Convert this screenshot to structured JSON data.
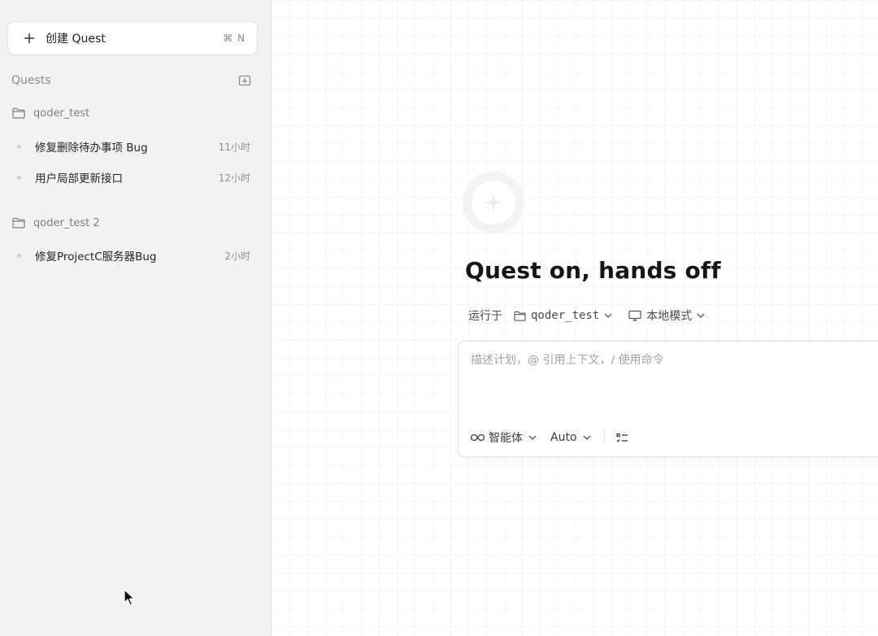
{
  "sidebar": {
    "new_quest": {
      "label": "创建 Quest",
      "shortcut": "⌘ N"
    },
    "section_title": "Quests",
    "groups": [
      {
        "folder": "qoder_test",
        "items": [
          {
            "title": "修复删除待办事项 Bug",
            "time": "11小时"
          },
          {
            "title": "用户局部更新接口",
            "time": "12小时"
          }
        ]
      },
      {
        "folder": "qoder_test 2",
        "items": [
          {
            "title": "修复ProjectC服务器Bug",
            "time": "2小时"
          }
        ]
      }
    ]
  },
  "main": {
    "headline": "Quest on, hands off",
    "run_label": "运行于",
    "workspace": "qoder_test",
    "mode": "本地模式",
    "composer": {
      "placeholder": "描述计划，@ 引用上下文，/ 使用命令",
      "agent_label": "智能体",
      "model_label": "Auto"
    }
  },
  "icons": {
    "new": "plus-icon",
    "import": "import-icon",
    "folder": "folder-icon",
    "monitor": "monitor-icon",
    "agent": "infinity-icon",
    "tasks": "checklist-icon",
    "chevron": "chevron-down-icon"
  },
  "colors": {
    "sidebar_bg": "#f2f2f3",
    "text_primary": "#1f1f1f",
    "text_muted": "#8b8b8b"
  }
}
